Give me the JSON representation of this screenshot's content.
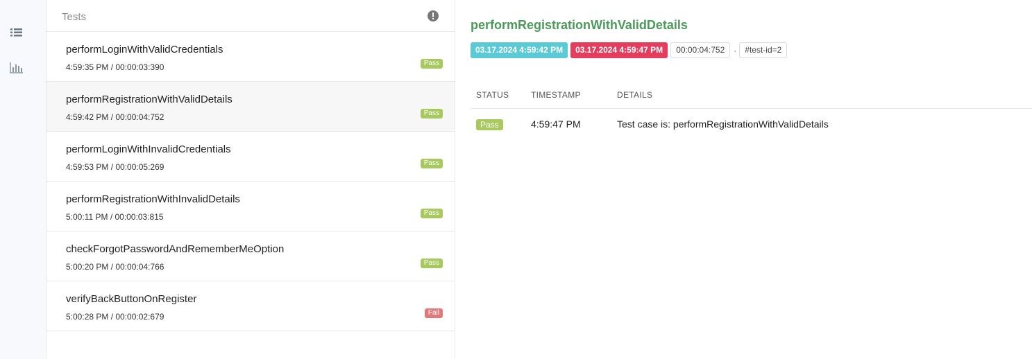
{
  "sidebar": {
    "icons": [
      "list-icon",
      "bar-chart-icon"
    ]
  },
  "tests_panel": {
    "title": "Tests",
    "items": [
      {
        "name": "performLoginWithValidCredentials",
        "meta": "4:59:35 PM / 00:00:03:390",
        "status": "Pass"
      },
      {
        "name": "performRegistrationWithValidDetails",
        "meta": "4:59:42 PM / 00:00:04:752",
        "status": "Pass"
      },
      {
        "name": "performLoginWithInvalidCredentials",
        "meta": "4:59:53 PM / 00:00:05:269",
        "status": "Pass"
      },
      {
        "name": "performRegistrationWithInvalidDetails",
        "meta": "5:00:11 PM / 00:00:03:815",
        "status": "Pass"
      },
      {
        "name": "checkForgotPasswordAndRememberMeOption",
        "meta": "5:00:20 PM / 00:00:04:766",
        "status": "Pass"
      },
      {
        "name": "verifyBackButtonOnRegister",
        "meta": "5:00:28 PM / 00:00:02:679",
        "status": "Fail"
      }
    ]
  },
  "detail": {
    "title": "performRegistrationWithValidDetails",
    "start_time": "03.17.2024 4:59:42 PM",
    "end_time": "03.17.2024 4:59:47 PM",
    "duration": "00:00:04:752",
    "separator": "·",
    "test_id": "#test-id=2",
    "table": {
      "headers": [
        "STATUS",
        "TIMESTAMP",
        "DETAILS"
      ],
      "rows": [
        {
          "status": "Pass",
          "timestamp": "4:59:47 PM",
          "details": "Test case is: performRegistrationWithValidDetails"
        }
      ]
    }
  },
  "colors": {
    "pass": "#a7c95e",
    "fail": "#e07a7a",
    "start_chip": "#5bc9d6",
    "end_chip": "#e33e5e",
    "title_green": "#4b9a5a"
  }
}
